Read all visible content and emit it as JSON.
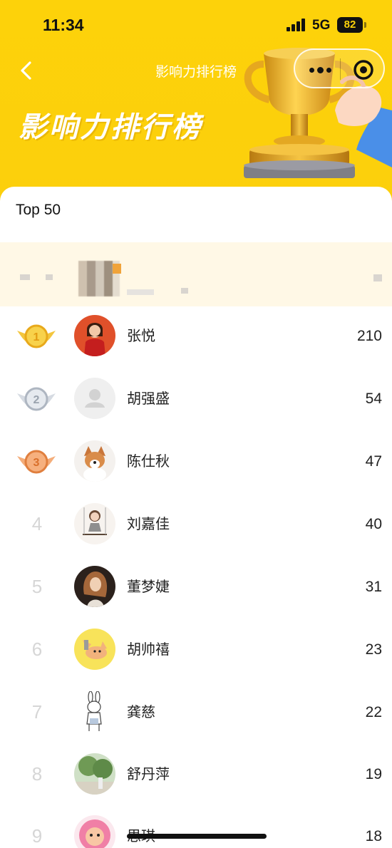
{
  "status_bar": {
    "time": "11:34",
    "network": "5G",
    "battery": "82"
  },
  "nav": {
    "title": "影响力排行榜"
  },
  "header": {
    "big_title": "影响力排行榜"
  },
  "list": {
    "top_label": "Top 50"
  },
  "ranking": [
    {
      "rank": "1",
      "name": "张悦",
      "score": "210"
    },
    {
      "rank": "2",
      "name": "胡强盛",
      "score": "54"
    },
    {
      "rank": "3",
      "name": "陈仕秋",
      "score": "47"
    },
    {
      "rank": "4",
      "name": "刘嘉佳",
      "score": "40"
    },
    {
      "rank": "5",
      "name": "董梦婕",
      "score": "31"
    },
    {
      "rank": "6",
      "name": "胡帅禧",
      "score": "23"
    },
    {
      "rank": "7",
      "name": "龚慈",
      "score": "22"
    },
    {
      "rank": "8",
      "name": "舒丹萍",
      "score": "19"
    },
    {
      "rank": "9",
      "name": "思琪",
      "score": "18"
    }
  ],
  "colors": {
    "accent": "#fdd20a",
    "my_row_bg": "#fff8e6",
    "gold": "#f3b51c",
    "silver": "#c5ccd6",
    "bronze": "#f09a5c"
  }
}
